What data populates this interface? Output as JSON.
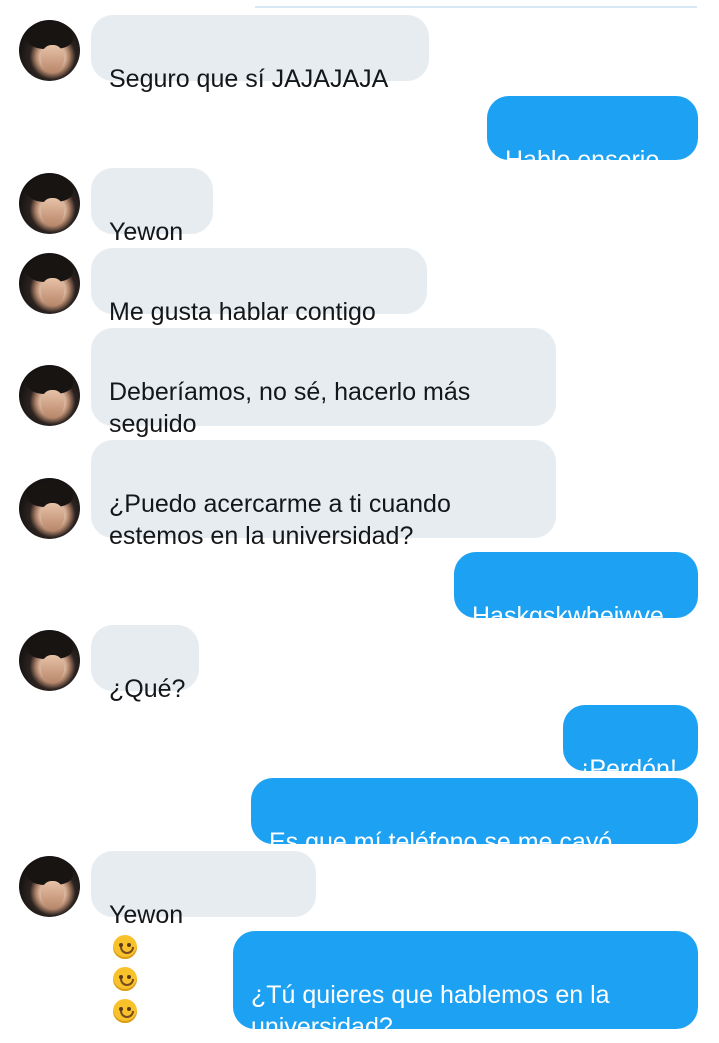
{
  "messages": [
    {
      "side": "received",
      "text": "Seguro que sí JAJAJAJA"
    },
    {
      "side": "sent",
      "text": "Hablo enserio"
    },
    {
      "side": "received",
      "text": "Yewon"
    },
    {
      "side": "received",
      "text": "Me gusta hablar contigo"
    },
    {
      "side": "received",
      "text": "Deberíamos, no sé, hacerlo más\nseguido"
    },
    {
      "side": "received",
      "text": "¿Puedo acercarme a ti cuando\nestemos en la universidad?"
    },
    {
      "side": "sent",
      "text": "Haskgskwheiwve"
    },
    {
      "side": "received",
      "text": "¿Qué?"
    },
    {
      "side": "sent",
      "text": "¡Perdón!"
    },
    {
      "side": "sent",
      "text": "Es que mí teléfono se me cayó"
    },
    {
      "side": "received",
      "text": "Yewon"
    },
    {
      "side": "sent",
      "text": "¿Tú quieres que hablemos en la\nuniversidad?"
    }
  ],
  "emoji": {
    "sad_face": "sad-face-emoji",
    "laughing": "rolling-on-floor-laughing-emoji"
  },
  "colors": {
    "sent_bubble": "#1da1f2",
    "received_bubble": "#e6ecf0",
    "received_text": "#14171a",
    "sent_text": "#ffffff"
  }
}
